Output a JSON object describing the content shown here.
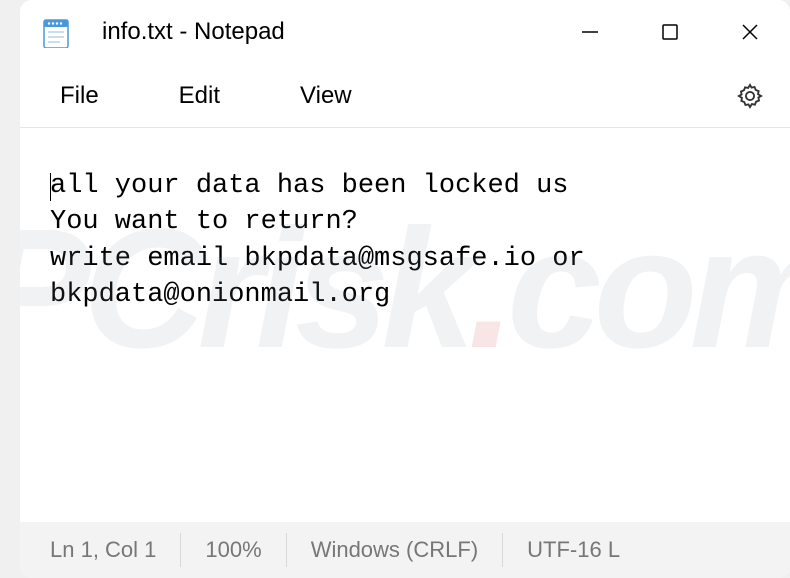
{
  "titlebar": {
    "title": "info.txt - Notepad"
  },
  "menubar": {
    "file": "File",
    "edit": "Edit",
    "view": "View"
  },
  "editor": {
    "content": "all your data has been locked us\nYou want to return?\nwrite email bkpdata@msgsafe.io or bkpdata@onionmail.org"
  },
  "statusbar": {
    "position": "Ln 1, Col 1",
    "zoom": "100%",
    "line_ending": "Windows (CRLF)",
    "encoding": "UTF-16 L"
  },
  "watermark": {
    "text_before": "PCrisk",
    "dot": ".",
    "text_after": "com"
  }
}
